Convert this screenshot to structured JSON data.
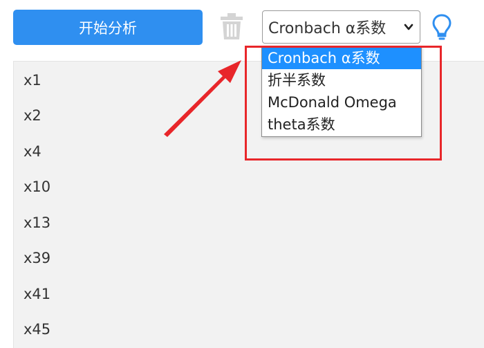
{
  "toolbar": {
    "analyze_label": "开始分析",
    "method_select_value": "Cronbach α系数"
  },
  "variables": [
    "x1",
    "x2",
    "x4",
    "x10",
    "x13",
    "x39",
    "x41",
    "x45"
  ],
  "dropdown": {
    "options": [
      "Cronbach α系数",
      "折半系数",
      "McDonald Omega",
      "theta系数"
    ],
    "selected_index": 0
  },
  "icons": {
    "delete": "trash-icon",
    "hint": "lightbulb-icon",
    "expand": "chevron-down-icon"
  },
  "colors": {
    "accent": "#2f8ff0",
    "selection": "#1e90ff",
    "annotation": "#e8262a",
    "panel_bg": "#f2f2f2"
  }
}
